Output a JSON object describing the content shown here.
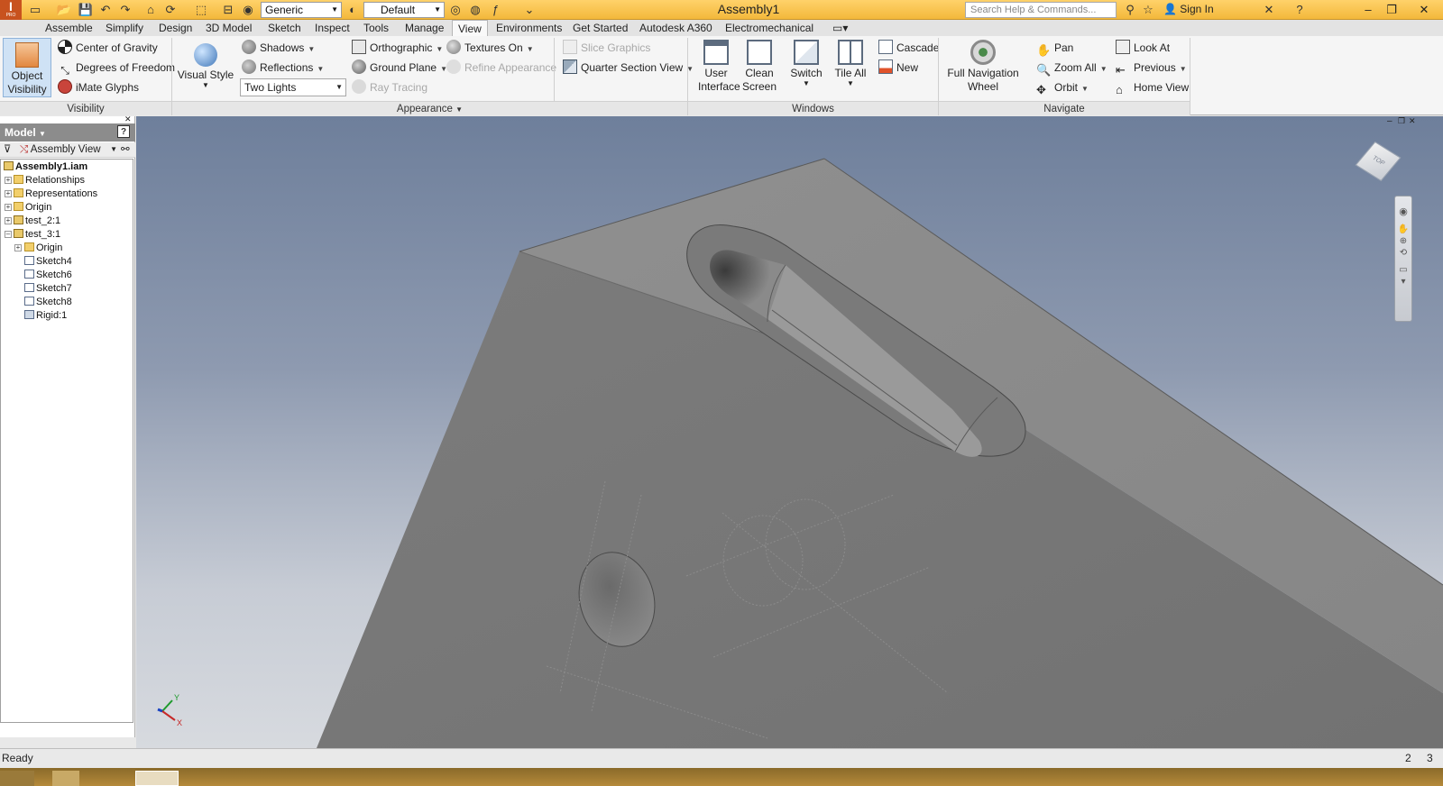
{
  "titlebar": {
    "app_letter": "I",
    "app_sub": "PRO",
    "material_select": "Generic",
    "appearance_select": "Default",
    "doc_title": "Assembly1",
    "search_placeholder": "Search Help & Commands...",
    "sign_in": "Sign In"
  },
  "tabs": [
    "Assemble",
    "Simplify",
    "Design",
    "3D Model",
    "Sketch",
    "Inspect",
    "Tools",
    "Manage",
    "View",
    "Environments",
    "Get Started",
    "Autodesk A360",
    "Electromechanical"
  ],
  "active_tab": "View",
  "ribbon": {
    "visibility": {
      "label": "Visibility",
      "object_visibility": "Object Visibility",
      "center_of_gravity": "Center of Gravity",
      "degrees_of_freedom": "Degrees of Freedom",
      "imate_glyphs": "iMate Glyphs"
    },
    "appearance": {
      "label": "Appearance",
      "visual_style": "Visual Style",
      "shadows": "Shadows",
      "reflections": "Reflections",
      "lights_select": "Two Lights",
      "orthographic": "Orthographic",
      "ground_plane": "Ground Plane",
      "ray_tracing": "Ray Tracing",
      "textures_on": "Textures On",
      "refine_appearance": "Refine Appearance",
      "slice_graphics": "Slice Graphics",
      "quarter_section_view": "Quarter Section View"
    },
    "windows": {
      "label": "Windows",
      "user_interface": "User Interface",
      "clean_screen": "Clean Screen",
      "switch": "Switch",
      "tile_all": "Tile All",
      "cascade": "Cascade",
      "new": "New"
    },
    "navigate": {
      "label": "Navigate",
      "full_navigation_wheel": "Full Navigation Wheel",
      "pan": "Pan",
      "zoom_all": "Zoom All",
      "orbit": "Orbit",
      "look_at": "Look At",
      "previous": "Previous",
      "home_view": "Home View"
    }
  },
  "browser": {
    "title": "Model",
    "view_select": "Assembly View",
    "tree": [
      {
        "label": "Assembly1.iam",
        "depth": 0,
        "icon": "assembly-icon",
        "bold": true
      },
      {
        "label": "Relationships",
        "depth": 1,
        "icon": "folder-icon"
      },
      {
        "label": "Representations",
        "depth": 1,
        "icon": "representations-icon"
      },
      {
        "label": "Origin",
        "depth": 1,
        "icon": "folder-icon"
      },
      {
        "label": "test_2:1",
        "depth": 1,
        "icon": "part-icon"
      },
      {
        "label": "test_3:1",
        "depth": 1,
        "icon": "part-icon"
      },
      {
        "label": "Origin",
        "depth": 2,
        "icon": "folder-icon"
      },
      {
        "label": "Sketch4",
        "depth": 2,
        "icon": "sketch-icon"
      },
      {
        "label": "Sketch6",
        "depth": 2,
        "icon": "sketch-icon"
      },
      {
        "label": "Sketch7",
        "depth": 2,
        "icon": "sketch-icon"
      },
      {
        "label": "Sketch8",
        "depth": 2,
        "icon": "sketch-icon"
      },
      {
        "label": "Rigid:1",
        "depth": 2,
        "icon": "constraint-icon"
      }
    ]
  },
  "viewcube": {
    "face": "TOP"
  },
  "axis_labels": {
    "x": "X",
    "y": "Y"
  },
  "status": {
    "text": "Ready",
    "num1": "2",
    "num2": "3"
  },
  "colors": {
    "titlebar": "#f3b83b",
    "active_tab": "#f9f9f9",
    "model_face": "#8a8a8a"
  }
}
